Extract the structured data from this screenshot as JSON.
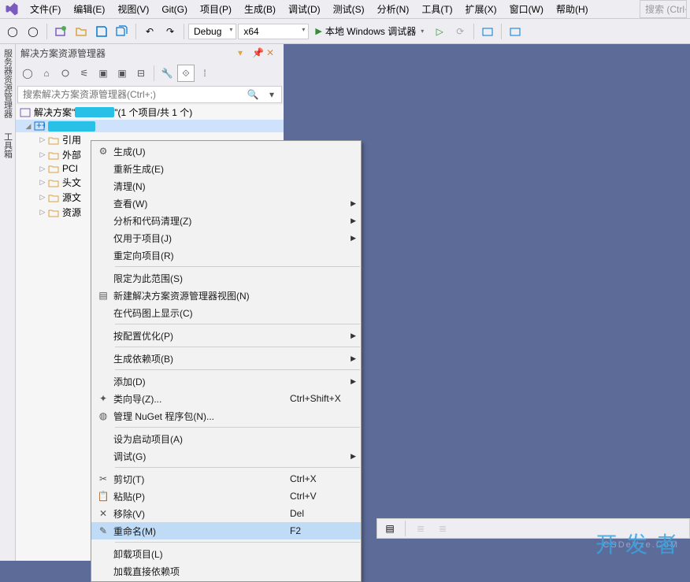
{
  "menubar": {
    "items": [
      "文件(F)",
      "编辑(E)",
      "视图(V)",
      "Git(G)",
      "项目(P)",
      "生成(B)",
      "调试(D)",
      "测试(S)",
      "分析(N)",
      "工具(T)",
      "扩展(X)",
      "窗口(W)",
      "帮助(H)"
    ],
    "search_placeholder": "搜索 (Ctrl+"
  },
  "toolbar": {
    "config": "Debug",
    "platform": "x64",
    "debugger": "本地 Windows 调试器"
  },
  "left_rail": {
    "label1": "服务器资源管理器",
    "label2": "工具箱"
  },
  "panel": {
    "title": "解决方案资源管理器",
    "search_placeholder": "搜索解决方案资源管理器(Ctrl+;)",
    "solution_prefix": "解决方案\"",
    "solution_suffix": "\"(1 个项目/共 1 个)",
    "tree": [
      {
        "label": "引用",
        "indent": 2
      },
      {
        "label": "外部",
        "indent": 2
      },
      {
        "label": "PCI",
        "indent": 2
      },
      {
        "label": "头文",
        "indent": 2
      },
      {
        "label": "源文",
        "indent": 2
      },
      {
        "label": "资源",
        "indent": 2
      }
    ]
  },
  "context_menu": {
    "groups": [
      [
        {
          "label": "生成(U)",
          "icon": "build"
        },
        {
          "label": "重新生成(E)"
        },
        {
          "label": "清理(N)"
        },
        {
          "label": "查看(W)",
          "sub": true
        },
        {
          "label": "分析和代码清理(Z)",
          "sub": true
        },
        {
          "label": "仅用于项目(J)",
          "sub": true
        },
        {
          "label": "重定向项目(R)"
        }
      ],
      [
        {
          "label": "限定为此范围(S)"
        },
        {
          "label": "新建解决方案资源管理器视图(N)",
          "icon": "newview"
        },
        {
          "label": "在代码图上显示(C)"
        }
      ],
      [
        {
          "label": "按配置优化(P)",
          "sub": true
        }
      ],
      [
        {
          "label": "生成依赖项(B)",
          "sub": true
        }
      ],
      [
        {
          "label": "添加(D)",
          "sub": true
        },
        {
          "label": "类向导(Z)...",
          "icon": "wizard",
          "shortcut": "Ctrl+Shift+X"
        },
        {
          "label": "管理 NuGet 程序包(N)...",
          "icon": "nuget"
        }
      ],
      [
        {
          "label": "设为启动项目(A)"
        },
        {
          "label": "调试(G)",
          "sub": true
        }
      ],
      [
        {
          "label": "剪切(T)",
          "icon": "cut",
          "shortcut": "Ctrl+X"
        },
        {
          "label": "粘贴(P)",
          "icon": "paste",
          "shortcut": "Ctrl+V"
        },
        {
          "label": "移除(V)",
          "icon": "remove",
          "shortcut": "Del"
        },
        {
          "label": "重命名(M)",
          "icon": "rename",
          "shortcut": "F2",
          "highlighted": true
        }
      ],
      [
        {
          "label": "卸载项目(L)"
        },
        {
          "label": "加载直接依赖项"
        }
      ]
    ]
  },
  "watermark": {
    "big": "开发者",
    "small": "CSDeVze.CoM"
  }
}
